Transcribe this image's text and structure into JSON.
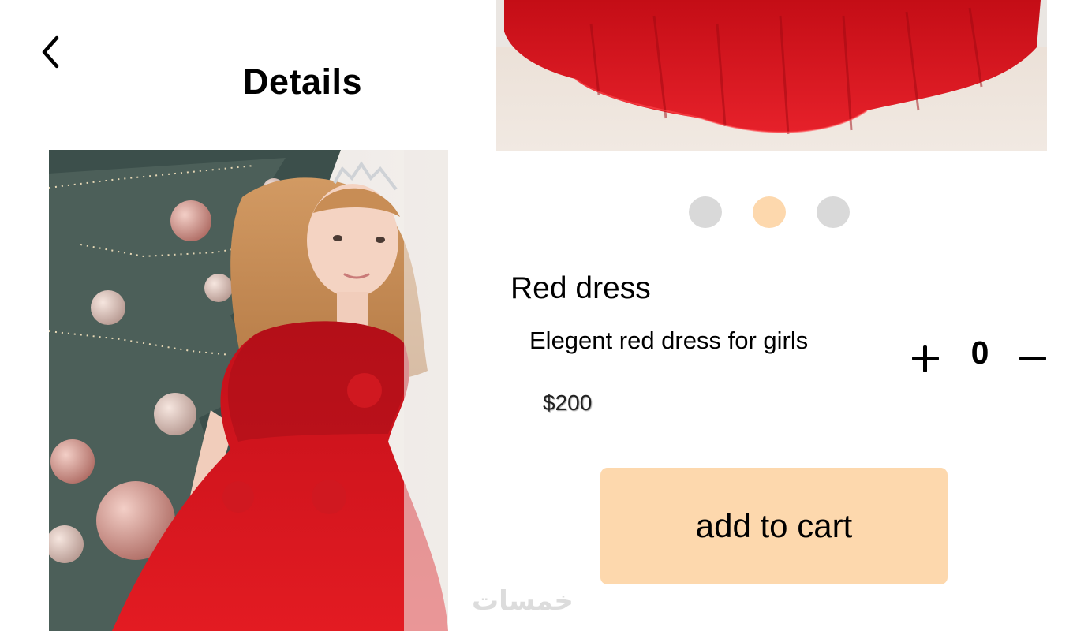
{
  "header": {
    "title": "Details",
    "back_icon": "chevron-left-icon"
  },
  "gallery": {
    "main_photo": "girl-in-red-dress-photo",
    "carousel_photo": "red-dress-hem-photo",
    "dots": [
      {
        "state": "inactive",
        "color": "#d9d9d9"
      },
      {
        "state": "active",
        "color": "#fdd8ad"
      },
      {
        "state": "inactive",
        "color": "#d9d9d9"
      }
    ]
  },
  "product": {
    "name": "Red dress",
    "description": "Elegent red dress for girls",
    "price": "$200"
  },
  "quantity": {
    "plus_icon": "plus-icon",
    "value": "0",
    "minus_icon": "minus-icon"
  },
  "actions": {
    "add_to_cart": "add to cart"
  },
  "watermark": {
    "text": "خمسات"
  },
  "colors": {
    "accent": "#fdd8ad",
    "dot_inactive": "#d9d9d9",
    "dress_red": "#e0101c"
  }
}
